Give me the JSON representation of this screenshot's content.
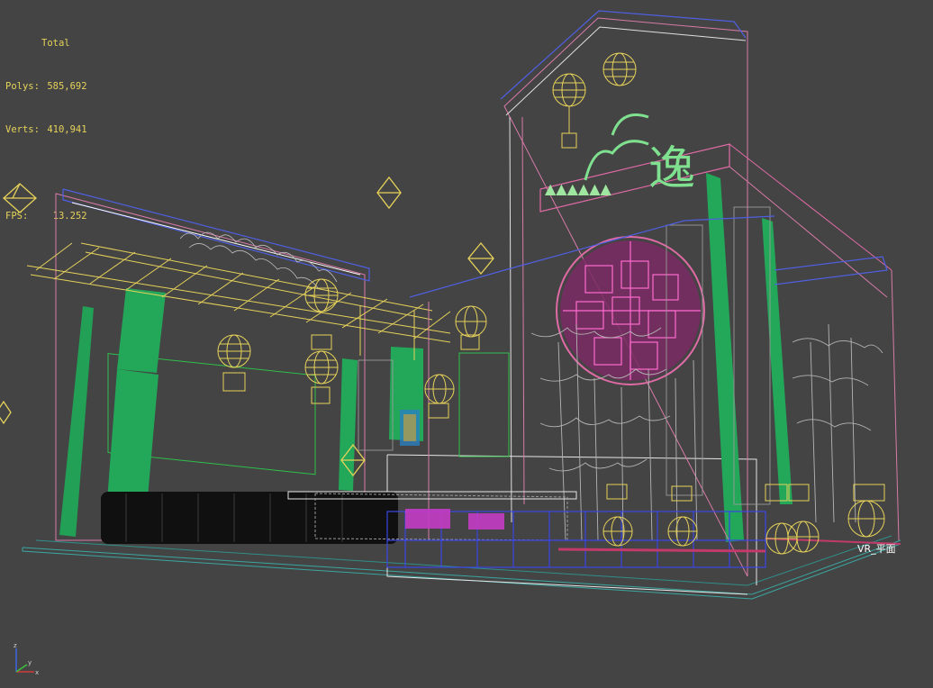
{
  "viewport_stats": {
    "header": "Total",
    "polys_label": "Polys:",
    "polys_value": "585,692",
    "verts_label": "Verts:",
    "verts_value": "410,941",
    "fps_label": "FPS:",
    "fps_value": "13.252"
  },
  "camera_label": "VR_平面",
  "signboard_text": "逸",
  "axis_gizmo": {
    "labels": [
      "z",
      "x",
      "y"
    ]
  },
  "colors": {
    "background": "#444444",
    "stats_text": "#e6d25a",
    "wire_green": "#1fa85a",
    "wire_yellow": "#e6d25a",
    "wire_magenta": "#d23cd2",
    "wire_blue": "#3a46e6",
    "wire_pink": "#e08ab6",
    "wire_gray": "#b4b4b4"
  }
}
